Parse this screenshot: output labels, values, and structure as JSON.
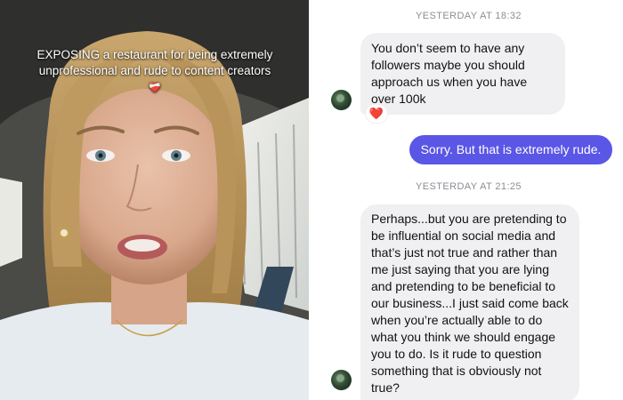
{
  "video": {
    "caption_emphasis": "EXPOSING",
    "caption_rest": " a restaurant for being extremely unprofessional and rude to content creators",
    "caption_emoji": "❤️‍🩹",
    "emoji_name": "mending-heart-icon"
  },
  "chat": {
    "accent_color": "#5a56e6",
    "messages": [
      {
        "type": "timestamp",
        "text": "YESTERDAY AT 18:32"
      },
      {
        "type": "incoming",
        "text": "You don’t seem to have any followers maybe you should approach us when you have over 100k",
        "reaction": "❤️",
        "reaction_icon": "heart-reaction-icon"
      },
      {
        "type": "outgoing",
        "text": "Sorry. But that is extremely rude."
      },
      {
        "type": "timestamp",
        "text": "YESTERDAY AT 21:25"
      },
      {
        "type": "incoming",
        "text": "Perhaps...but you are pretending to be influential on social media and that’s just not true and rather than me just saying that you are lying and pretending to be beneficial to our business...I just said come back when you’re actually able to do what you think we should engage you to do. Is it rude to question something that is obviously not true?"
      }
    ]
  }
}
